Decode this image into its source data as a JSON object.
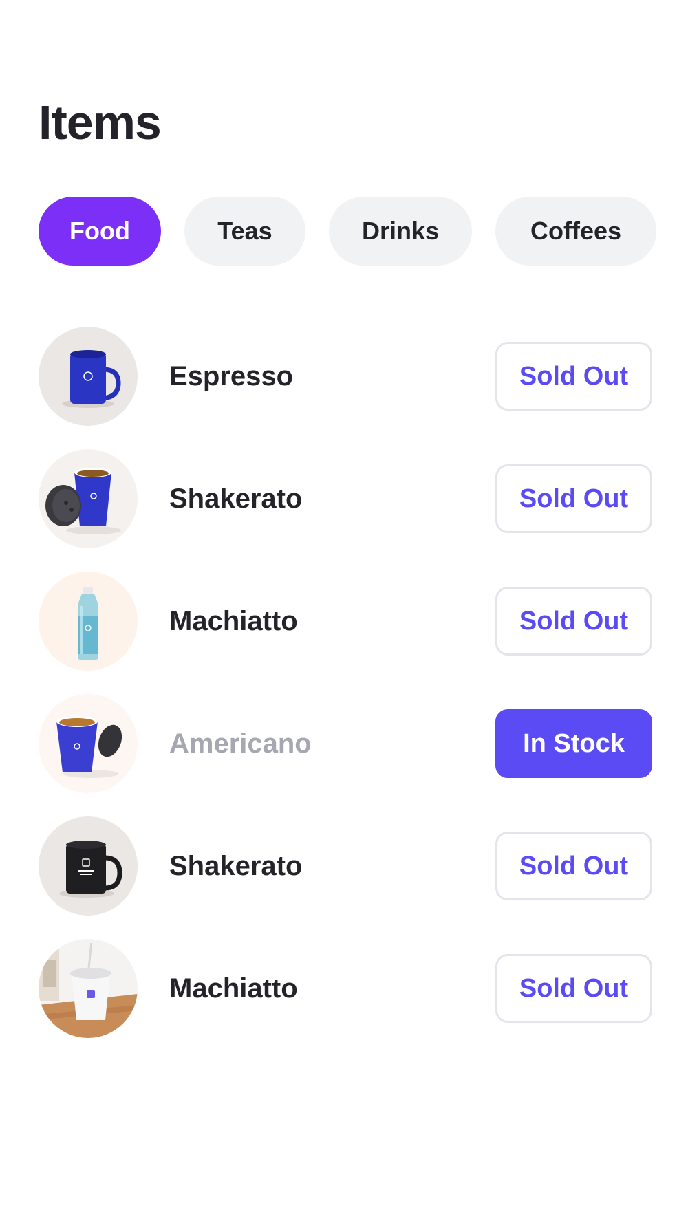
{
  "page": {
    "title": "Items"
  },
  "tabs": [
    {
      "label": "Food",
      "active": true
    },
    {
      "label": "Teas",
      "active": false
    },
    {
      "label": "Drinks",
      "active": false
    },
    {
      "label": "Coffees",
      "active": false
    }
  ],
  "items": [
    {
      "name": "Espresso",
      "status": "Sold Out",
      "image": "blue-mug-icon"
    },
    {
      "name": "Shakerato",
      "status": "Sold Out",
      "image": "blue-cup-with-lid-icon"
    },
    {
      "name": "Machiatto",
      "status": "Sold Out",
      "image": "water-bottle-icon"
    },
    {
      "name": "Americano",
      "status": "In Stock",
      "image": "blue-cup-with-coffee-icon"
    },
    {
      "name": "Shakerato",
      "status": "Sold Out",
      "image": "black-mug-icon"
    },
    {
      "name": "Machiatto",
      "status": "Sold Out",
      "image": "iced-cup-icon"
    }
  ],
  "colors": {
    "accent_purple": "#7b2ff7",
    "status_indigo": "#5b4bf5",
    "tab_inactive_bg": "#f1f2f4",
    "muted_text": "#a6a7b1"
  }
}
